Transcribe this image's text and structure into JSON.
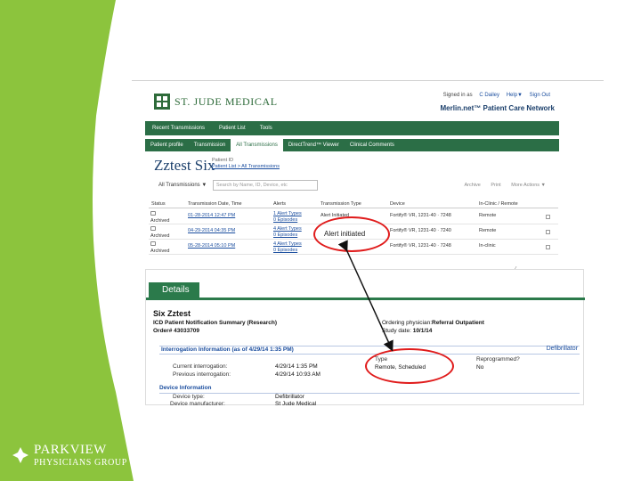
{
  "colors": {
    "band_green": "#8cc43d",
    "nav_green": "#2b6e46",
    "link_blue": "#1a4d9e",
    "annotation_red": "#e01b1b"
  },
  "slide_logo": {
    "line1": "PARKVIEW",
    "line2": "PHYSICIANS GROUP",
    "icon": "parkview-mark-icon"
  },
  "merlin": {
    "brand": "ST. JUDE MEDICAL",
    "product": "Merlin.net™ Patient Care Network",
    "user_bar": {
      "signed_in": "Signed in as",
      "user": "C Dailey",
      "help": "Help▼",
      "sign_out": "Sign Out"
    },
    "top_nav": [
      "Recent Transmissions",
      "Patient List",
      "Tools"
    ],
    "patient_nav": [
      "Patient profile",
      "Transmission",
      "All Transmissions",
      "DirectTrend™ Viewer",
      "Clinical Comments"
    ],
    "patient_name": "Zztest Six",
    "patient_id_label": "Patient ID",
    "breadcrumb": "Patient List > All Transmissions",
    "filter_label": "All Transmissions ▼",
    "search_placeholder": "Search by Name, ID, Device, etc",
    "toolbar": [
      "Archive",
      "Print",
      "More Actions ▼"
    ],
    "table": {
      "headers": [
        "Status",
        "Transmission Date, Time",
        "Alerts",
        "Transmission Type",
        "Device",
        "In-Clinic / Remote"
      ],
      "rows": [
        {
          "status": "Archived",
          "date": "01-28-2014 12:47 PM",
          "alerts1": "1 Alert Types",
          "alerts2": "0 Episodes",
          "type": "Alert Initiated",
          "device": "Fortify® VR, 1231-40 · 7248",
          "mode": "Remote"
        },
        {
          "status": "Archived",
          "date": "04-29-2014 04:35 PM",
          "alerts1": "4 Alert Types",
          "alerts2": "0 Episodes",
          "type": "Alert Initiated",
          "device": "Fortify® VR, 1231-40 · 7240",
          "mode": "Remote"
        },
        {
          "status": "Archived",
          "date": "05-28-2014 05:10 PM",
          "alerts1": "4 Alert Types",
          "alerts2": "0 Episodes",
          "type": "",
          "device": "Fortify® VR, 1231-40 · 7248",
          "mode": "In-clinic"
        }
      ]
    }
  },
  "details": {
    "tab": "Details",
    "name": "Six Zztest",
    "report_title": "ICD Patient Notification Summary (Research)",
    "order": "Order# 43033709",
    "ordering_label": "Ordering physician:",
    "ordering_value": "Referral Outpatient",
    "study_label": "Study date:",
    "study_value": "10/1/14",
    "interrogation_header": "Interrogation Information (as of 4/29/14 1:35 PM)",
    "defibrillator_label": "Defibrillator",
    "current_label": "Current interrogation:",
    "current_value": "4/29/14  1:35 PM",
    "previous_label": "Previous interrogation:",
    "previous_value": "4/29/14 10:93 AM",
    "type_label": "Type",
    "type_value": "Remote, Scheduled",
    "reprogrammed_label": "Reprogrammed?",
    "reprogrammed_value": "No",
    "device_header": "Device Information",
    "device_type_label": "Device type:",
    "device_type_value": "Defibrillator",
    "manufacturer_label": "Device manufacturer:",
    "manufacturer_value": "St Jude Medical"
  },
  "annotation": {
    "zoom_text": "Alert initiated"
  }
}
